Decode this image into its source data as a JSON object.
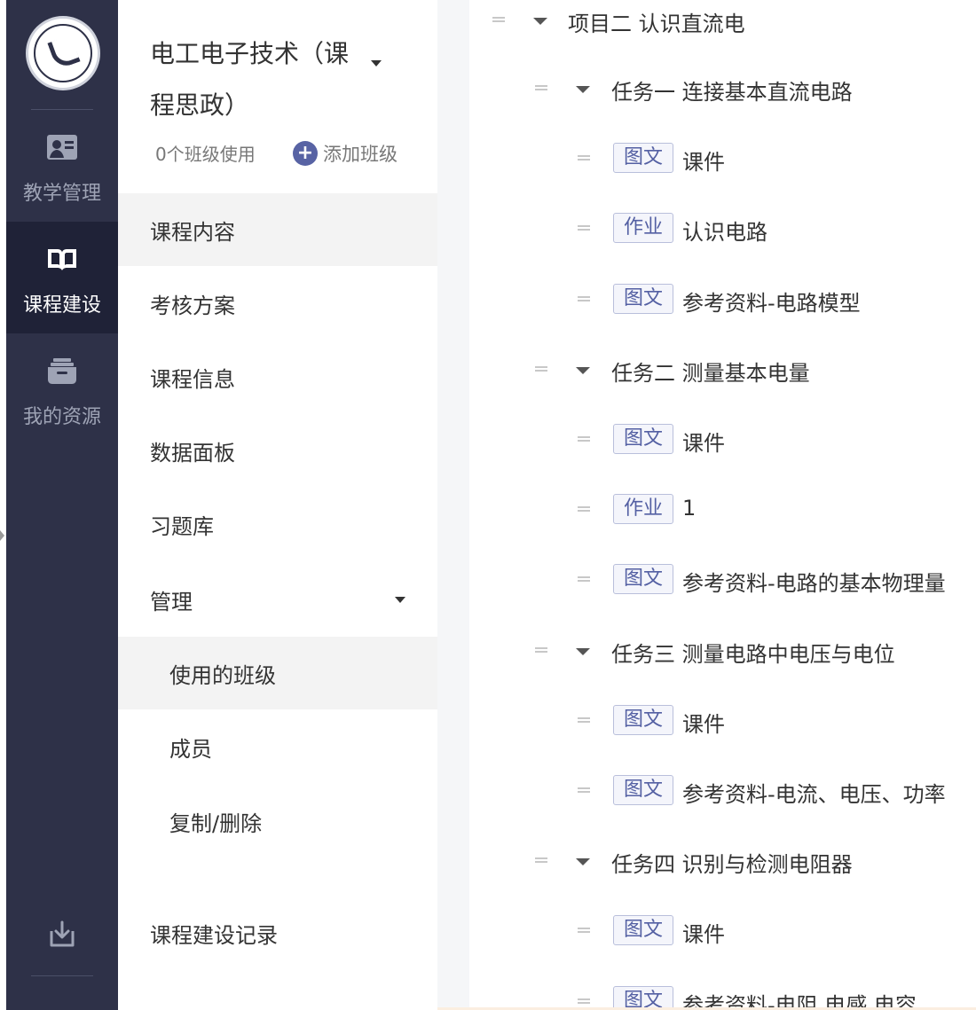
{
  "rail": {
    "items": [
      {
        "label": "教学管理",
        "icon": "teacher-card-icon",
        "active": false
      },
      {
        "label": "课程建设",
        "icon": "open-book-icon",
        "active": true
      },
      {
        "label": "我的资源",
        "icon": "archive-box-icon",
        "active": false
      }
    ],
    "bottom_icon": "download-tray-icon"
  },
  "subnav": {
    "course_title": "电工电子技术（课程思政）",
    "class_count": "0个班级使用",
    "add_class": "添加班级",
    "items": [
      {
        "label": "课程内容"
      },
      {
        "label": "考核方案"
      },
      {
        "label": "课程信息"
      },
      {
        "label": "数据面板"
      },
      {
        "label": "习题库"
      },
      {
        "label": "管理"
      },
      {
        "label": "使用的班级"
      },
      {
        "label": "成员"
      },
      {
        "label": "复制/删除"
      },
      {
        "label": "课程建设记录"
      }
    ]
  },
  "content": {
    "project": "项目二 认识直流电",
    "rows": [
      {
        "kind": "task",
        "title": "任务一 连接基本直流电路"
      },
      {
        "kind": "item",
        "tag": "图文",
        "title": "课件"
      },
      {
        "kind": "item",
        "tag": "作业",
        "title": "认识电路"
      },
      {
        "kind": "item",
        "tag": "图文",
        "title": "参考资料-电路模型"
      },
      {
        "kind": "task",
        "title": "任务二 测量基本电量"
      },
      {
        "kind": "item",
        "tag": "图文",
        "title": "课件"
      },
      {
        "kind": "item",
        "tag": "作业",
        "title": "1"
      },
      {
        "kind": "item",
        "tag": "图文",
        "title": "参考资料-电路的基本物理量"
      },
      {
        "kind": "task",
        "title": "任务三 测量电路中电压与电位"
      },
      {
        "kind": "item",
        "tag": "图文",
        "title": "课件"
      },
      {
        "kind": "item",
        "tag": "图文",
        "title": "参考资料-电流、电压、功率"
      },
      {
        "kind": "task",
        "title": "任务四 识别与检测电阻器"
      },
      {
        "kind": "item",
        "tag": "图文",
        "title": "课件"
      },
      {
        "kind": "item",
        "tag": "图文",
        "title": "参考资料-电阻 电感 电容"
      }
    ]
  },
  "colors": {
    "rail": "#2e3148",
    "rail_active": "#1f2237",
    "accent": "#5863a4"
  }
}
